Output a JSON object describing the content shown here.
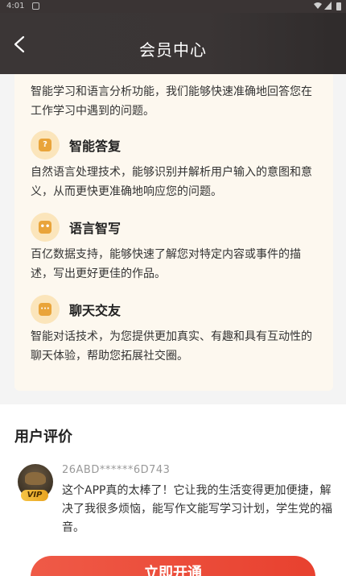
{
  "status_bar": {
    "time": "4:01"
  },
  "header": {
    "title": "会员中心"
  },
  "features": {
    "intro_desc": "智能学习和语言分析功能，我们能够快速准确地回答您在工作学习中遇到的问题。",
    "items": [
      {
        "title": "智能答复",
        "icon": "question-bubble-icon",
        "desc": "自然语言处理技术，能够识别并解析用户输入的意图和意义，从而更快更准确地响应您的问题。"
      },
      {
        "title": "语言智写",
        "icon": "robot-face-icon",
        "desc": "百亿数据支持，能够快速了解您对特定内容或事件的描述，写出更好更佳的作品。"
      },
      {
        "title": "聊天交友",
        "icon": "chat-bubble-icon",
        "desc": "智能对话技术，为您提供更加真实、有趣和具有互动性的聊天体验，帮助您拓展社交圈。"
      }
    ]
  },
  "reviews": {
    "heading": "用户评价",
    "items": [
      {
        "user": "26ABD******6D743",
        "badge": "VIP",
        "text": "这个APP真的太棒了！它让我的生活变得更加便捷，解决了我很多烦恼，能写作文能写学习计划，学生党的福音。"
      }
    ]
  },
  "cta": {
    "label": "立即开通"
  },
  "colors": {
    "header_bg": "#3a3535",
    "card_bg": "#fdf8ef",
    "accent": "#e9a43a",
    "cta": "#e8412f"
  }
}
